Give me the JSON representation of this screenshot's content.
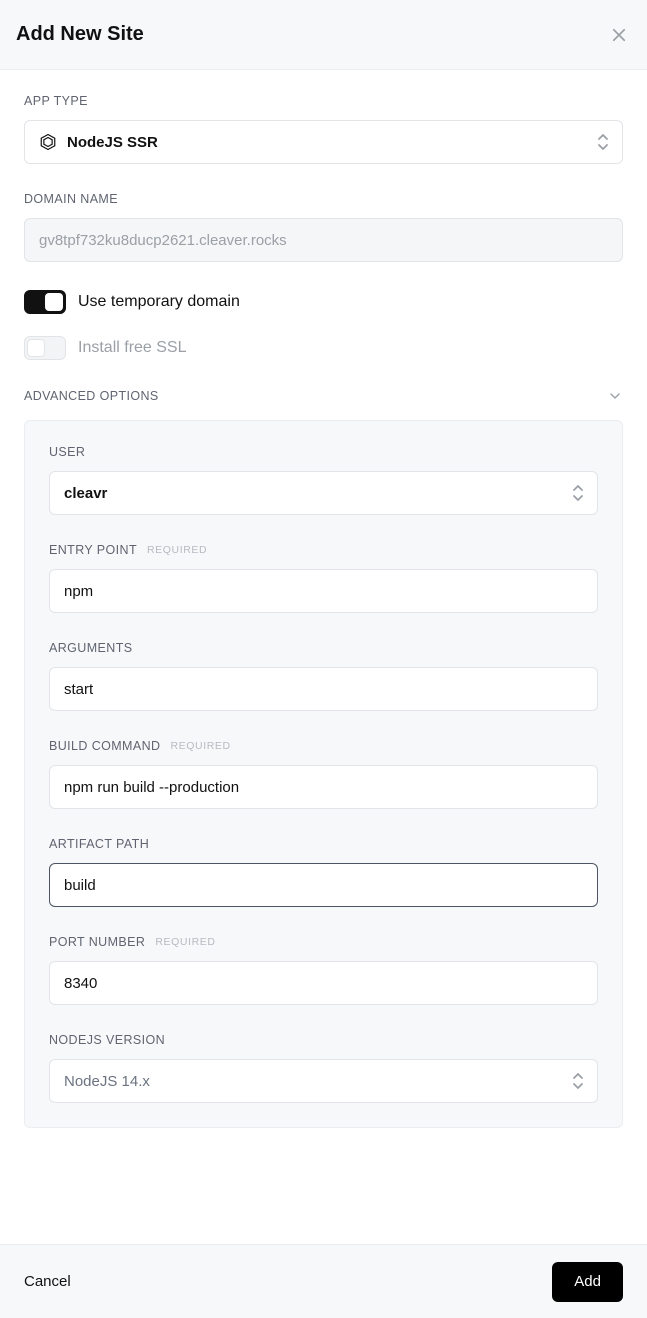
{
  "header": {
    "title": "Add New Site"
  },
  "appType": {
    "label": "APP TYPE",
    "value": "NodeJS SSR"
  },
  "domainName": {
    "label": "DOMAIN NAME",
    "value": "gv8tpf732ku8ducp2621.cleaver.rocks"
  },
  "toggles": {
    "tempDomain": {
      "label": "Use temporary domain",
      "on": true
    },
    "freeSSL": {
      "label": "Install free SSL",
      "on": false
    }
  },
  "advanced": {
    "label": "ADVANCED OPTIONS",
    "user": {
      "label": "USER",
      "value": "cleavr"
    },
    "entryPoint": {
      "label": "ENTRY POINT",
      "required": "REQUIRED",
      "value": "npm"
    },
    "arguments": {
      "label": "ARGUMENTS",
      "value": "start"
    },
    "buildCmd": {
      "label": "BUILD COMMAND",
      "required": "REQUIRED",
      "value": "npm run build --production"
    },
    "artifact": {
      "label": "ARTIFACT PATH",
      "value": "build"
    },
    "port": {
      "label": "PORT NUMBER",
      "required": "REQUIRED",
      "value": "8340"
    },
    "nodeVersion": {
      "label": "NODEJS VERSION",
      "value": "NodeJS 14.x"
    }
  },
  "footer": {
    "cancel": "Cancel",
    "add": "Add"
  }
}
